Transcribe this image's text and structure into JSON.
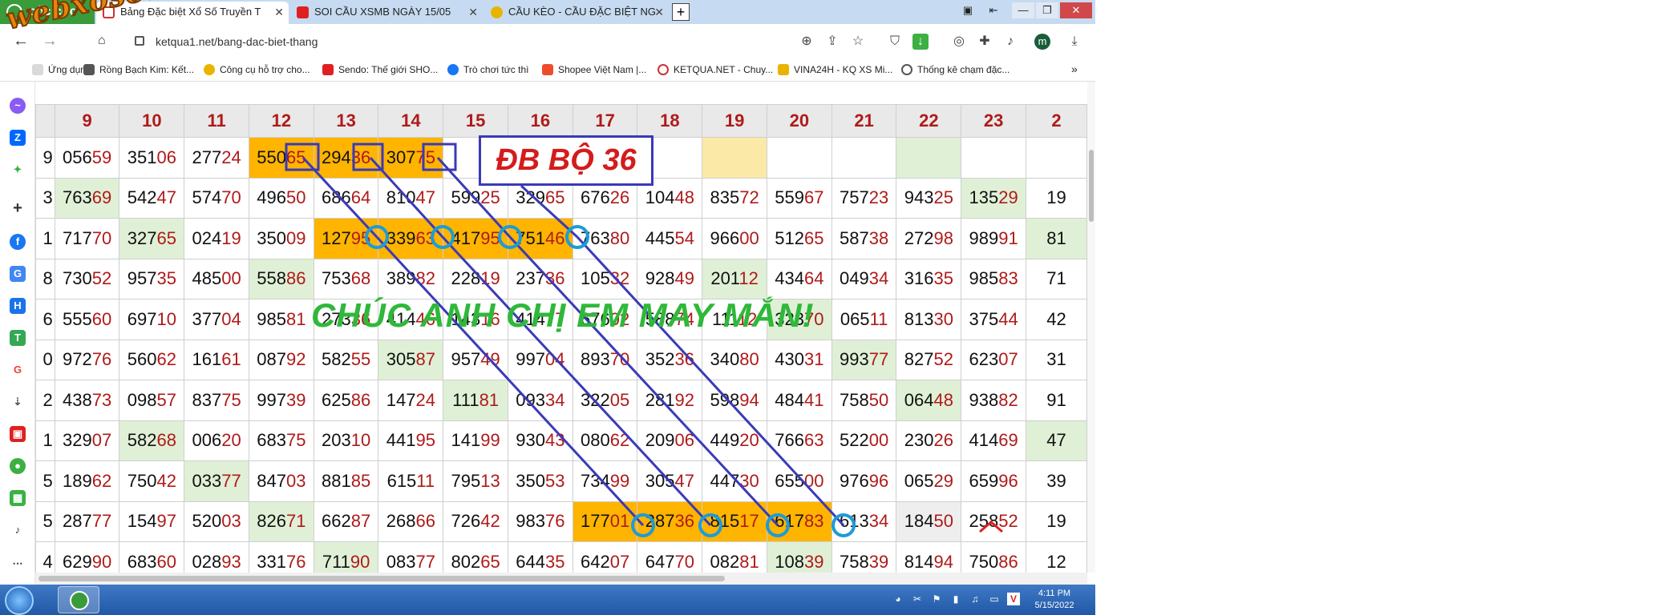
{
  "watermark": "webxoso.net",
  "browser": {
    "brand": "cốc cốc",
    "tabs": [
      {
        "title": "Bảng Đặc biệt Xổ Số Truyền T",
        "active": true
      },
      {
        "title": "SOI CẦU XSMB NGÀY 15/05",
        "active": false
      },
      {
        "title": "CẦU KÈO - CẦU ĐẶC BIỆT NG",
        "active": false
      }
    ],
    "url": "ketqua1.net/bang-dac-biet-thang",
    "bookmarks": [
      "Ứng dụng",
      "Rồng Bạch Kim: Kết...",
      "Công cụ hỗ trợ cho...",
      "Sendo: Thế giới SHO...",
      "Trò chơi tức thì",
      "Shopee Việt Nam |...",
      "KETQUA.NET - Chuy...",
      "VINA24H - KQ XS Mi...",
      "Thống kê chạm đặc..."
    ],
    "profile_initial": "m"
  },
  "table": {
    "headers": [
      "9",
      "10",
      "11",
      "12",
      "13",
      "14",
      "15",
      "16",
      "17",
      "18",
      "19",
      "20",
      "21",
      "22",
      "23",
      "2"
    ],
    "first_col": [
      "9",
      "3",
      "1",
      "8",
      "6",
      "0",
      "2",
      "1",
      "5",
      "5",
      "4"
    ],
    "rows": [
      [
        "05659",
        "35106",
        "27724",
        "55065",
        "29436",
        "30775",
        "",
        "",
        "",
        "",
        "",
        "",
        "",
        "",
        "",
        ""
      ],
      [
        "76369",
        "54247",
        "57470",
        "49650",
        "68664",
        "81047",
        "59925",
        "32965",
        "67626",
        "10448",
        "83572",
        "55967",
        "75723",
        "94325",
        "13529",
        "19"
      ],
      [
        "71770",
        "32765",
        "02419",
        "35009",
        "12795",
        "33963",
        "41795",
        "75146",
        "76380",
        "44554",
        "96600",
        "51265",
        "58738",
        "27298",
        "98991",
        "81"
      ],
      [
        "73052",
        "95735",
        "48500",
        "55886",
        "75368",
        "38982",
        "22819",
        "23736",
        "10532",
        "92849",
        "20112",
        "43464",
        "04934",
        "31635",
        "98583",
        "71"
      ],
      [
        "55560",
        "69710",
        "37704",
        "98581",
        "27336",
        "41446",
        "14316",
        "41477",
        "67602",
        "58874",
        "11112",
        "32370",
        "06511",
        "81330",
        "37544",
        "42"
      ],
      [
        "97276",
        "56062",
        "16161",
        "08792",
        "58255",
        "30587",
        "95749",
        "99704",
        "89370",
        "35236",
        "34080",
        "43031",
        "99377",
        "82752",
        "62307",
        "31"
      ],
      [
        "43873",
        "09857",
        "83775",
        "99739",
        "62586",
        "14724",
        "11181",
        "09334",
        "32205",
        "28192",
        "59894",
        "48441",
        "75850",
        "06448",
        "93882",
        "91"
      ],
      [
        "32907",
        "58268",
        "00620",
        "68375",
        "20310",
        "44195",
        "14199",
        "93043",
        "08062",
        "20906",
        "44920",
        "76663",
        "52200",
        "23026",
        "41469",
        "47"
      ],
      [
        "18962",
        "75042",
        "03377",
        "84703",
        "88185",
        "61511",
        "79513",
        "35053",
        "73499",
        "30547",
        "44730",
        "65500",
        "97696",
        "06529",
        "65996",
        "39"
      ],
      [
        "28777",
        "15497",
        "52003",
        "82671",
        "66287",
        "26866",
        "72642",
        "98376",
        "17701",
        "28736",
        "81517",
        "61783",
        "61334",
        "18450",
        "25852",
        "19"
      ],
      [
        "62990",
        "68360",
        "02893",
        "33176",
        "71190",
        "08377",
        "80265",
        "64435",
        "64207",
        "64770",
        "08281",
        "10839",
        "75839",
        "81494",
        "75086",
        "12"
      ]
    ],
    "cell_classes": [
      [
        "",
        "",
        "",
        "gold",
        "gold",
        "gold",
        "",
        "",
        "",
        "",
        "pale",
        "",
        "",
        "green",
        "",
        ""
      ],
      [
        "green",
        "",
        "",
        "",
        "",
        "",
        "",
        "",
        "",
        "",
        "",
        "",
        "",
        "",
        "green",
        ""
      ],
      [
        "",
        "green",
        "",
        "",
        "gold",
        "gold",
        "gold",
        "gold",
        "",
        "",
        "",
        "",
        "",
        "",
        "",
        "green"
      ],
      [
        "",
        "",
        "",
        "green",
        "",
        "",
        "",
        "",
        "",
        "",
        "green",
        "",
        "",
        "",
        "",
        ""
      ],
      [
        "",
        "",
        "",
        "",
        "",
        "",
        "",
        "",
        "",
        "",
        "",
        "green",
        "",
        "",
        "",
        ""
      ],
      [
        "",
        "",
        "",
        "",
        "",
        "green",
        "",
        "",
        "",
        "",
        "",
        "",
        "green",
        "",
        "",
        ""
      ],
      [
        "",
        "",
        "",
        "",
        "",
        "",
        "green",
        "",
        "",
        "",
        "",
        "",
        "",
        "green",
        "",
        ""
      ],
      [
        "",
        "green",
        "",
        "",
        "",
        "",
        "",
        "",
        "",
        "",
        "",
        "",
        "",
        "",
        "",
        "green"
      ],
      [
        "",
        "",
        "green",
        "",
        "",
        "",
        "",
        "",
        "",
        "",
        "",
        "",
        "",
        "",
        "",
        ""
      ],
      [
        "",
        "",
        "",
        "green",
        "",
        "",
        "",
        "",
        "gold",
        "gold",
        "gold",
        "gold",
        "",
        "grey",
        "",
        ""
      ],
      [
        "",
        "",
        "",
        "",
        "green",
        "",
        "",
        "",
        "",
        "",
        "",
        "green",
        "",
        "",
        "",
        ""
      ]
    ]
  },
  "annotations": {
    "db_label": "ĐB BỘ 36",
    "wish": "CHÚC ANH CHỊ EM MAY MẮN!"
  },
  "taskbar": {
    "time": "4:11 PM",
    "date": "5/15/2022"
  },
  "colors": {
    "accent_gold": "#ffb400",
    "line_blue": "#3a3ab8",
    "circle_blue": "#1e9bd7",
    "tail_red": "#b01a1a",
    "wish_green": "#2fb83a"
  }
}
